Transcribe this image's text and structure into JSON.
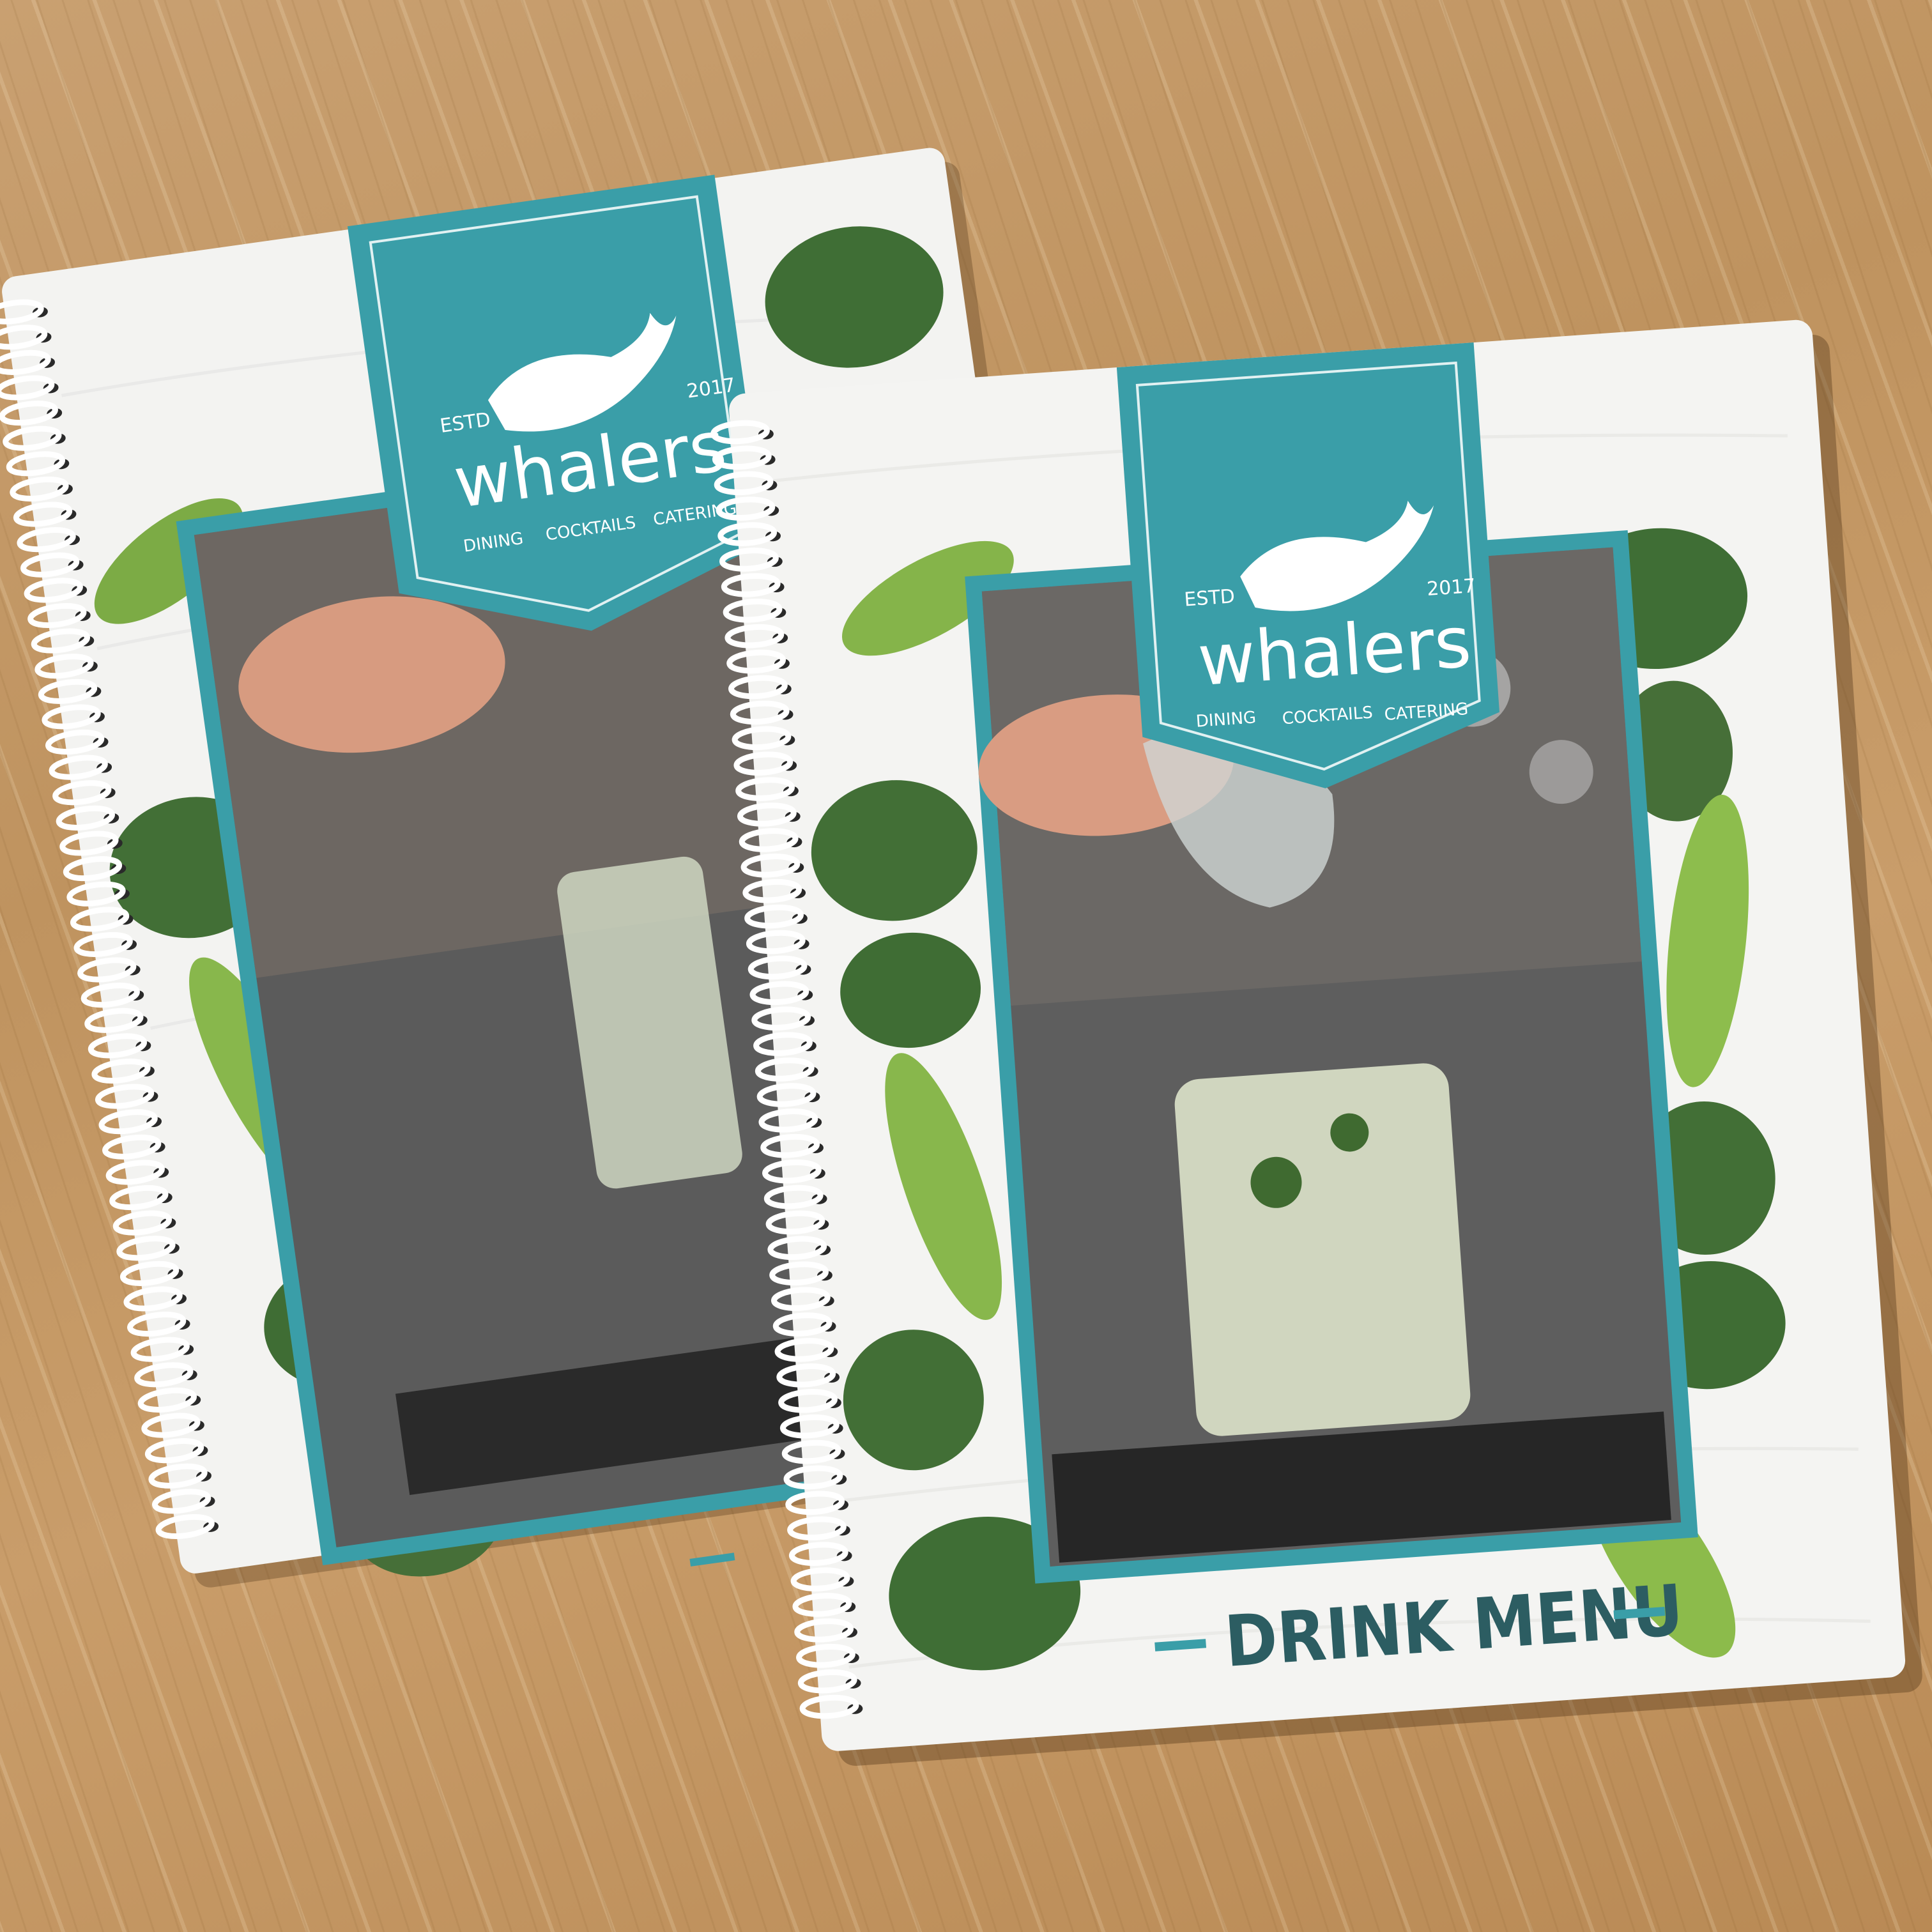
{
  "scene": {
    "description_colors": {
      "table": "#c29664",
      "cover": "#f4f4f2",
      "banner": "#3a9ea8",
      "photo_frame": "#3a9ea8",
      "title_color": "#2c5d62",
      "leaf_dark": "#3f6f34",
      "leaf_light": "#8fbf4a",
      "spiral": "#ffffff"
    }
  },
  "back_menu": {
    "brand": "whalers",
    "estd": "ESTD",
    "year": "2017",
    "tagline": [
      "DINING",
      "COCKTAILS",
      "CATERING"
    ]
  },
  "front_menu": {
    "brand": "whalers",
    "estd": "ESTD",
    "year": "2017",
    "tagline": [
      "DINING",
      "COCKTAILS",
      "CATERING"
    ],
    "title": "DRINK MENU"
  }
}
